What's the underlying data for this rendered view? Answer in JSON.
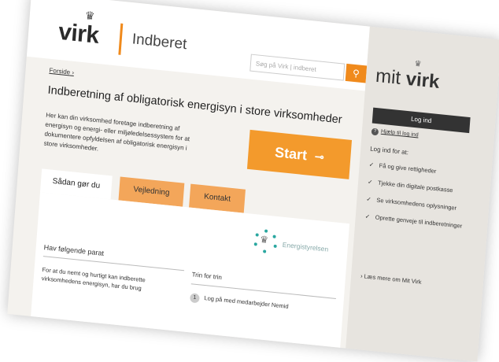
{
  "header": {
    "logo": "virk",
    "section": "Indberet",
    "search_placeholder": "Søg på Virk | indberet",
    "search_icon": "search-icon"
  },
  "breadcrumb": "Forside",
  "page_title": "Indberetning af obligatorisk energisyn i store virksomheder",
  "intro": "Her kan din virksomhed foretage indberetning af energisyn og energi- eller miljøledelsessystem for at dokumentere opfyldelsen af obligatorisk energisyn i store virksomheder.",
  "start_label": "Start",
  "tabs": [
    "Sådan gør du",
    "Vejledning",
    "Kontakt"
  ],
  "panel": {
    "agency": "Energistyrelsen",
    "col1_heading": "Hav følgende parat",
    "col1_text": "For at du nemt og hurtigt kan indberette virksomhedens energisyn, har du brug",
    "col2_heading": "Trin for trin",
    "step_number": "1",
    "step_text": "Log på med medarbejder Nemid"
  },
  "sidebar": {
    "title_prefix": "mit",
    "title_brand": "virk",
    "login_label": "Log ind",
    "help_label": "Hjælp til log ind",
    "login_for": "Log ind for at:",
    "items": [
      "Få og give rettigheder",
      "Tjekke din digitale postkasse",
      "Se virksomhedens oplysninger",
      "Oprette genveje til indberetninger"
    ],
    "more": "Læs mere om Mit Virk"
  },
  "colors": {
    "accent": "#f08a1c",
    "tab": "#f3a65a",
    "dark": "#333333"
  }
}
